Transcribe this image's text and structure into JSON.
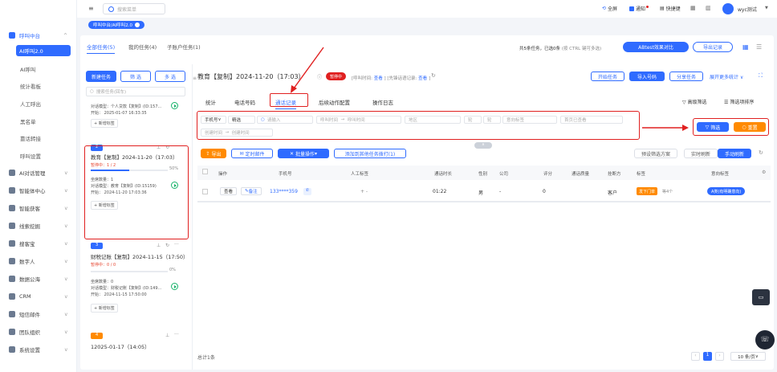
{
  "topbar": {
    "search_placeholder": "搜索菜单",
    "links": [
      "全屏",
      "通知",
      "快捷键"
    ],
    "user": "wyc测试"
  },
  "breadcrumb": "呼叫中台/AI呼叫2.0",
  "sidebar": {
    "top_item": "呼叫中台",
    "sub_items": [
      "AI呼叫2.0",
      "AI呼叫",
      "统计看板",
      "人工呼出",
      "黑名单",
      "靠话转接",
      "呼叫设置"
    ],
    "groups": [
      "AI对话管理",
      "智能体中心",
      "智能获客",
      "线索挖掘",
      "搜客宝",
      "数字人",
      "数据公海",
      "CRM",
      "短信邮件",
      "团队组织",
      "系统设置"
    ]
  },
  "panel": {
    "tabs": [
      "全部任务(5)",
      "我的任务(4)",
      "子账户任务(1)"
    ],
    "summary": "共5条任务，已选0条",
    "summary_hint": "(按 CTRL 键可多选)",
    "abtest": "ABtest效果对比",
    "export_records": "导出记录",
    "left_buttons": {
      "new_task": "新建任务",
      "filter": "筛 选",
      "multi": "多 选"
    },
    "left_search_placeholder": "搜索任务(回车)",
    "task_title": "教育【复制】2024-11-20（17:03）",
    "task_status": "暂停中",
    "task_meta_1": "[呼叫时间:",
    "task_meta_link_1": "查看",
    "task_meta_2": "] [先锋话语记录:",
    "task_meta_link_2": "查看",
    "task_meta_3": "]",
    "header_buttons": [
      "开始任务",
      "导入号码",
      "分享任务",
      "展开更多统计"
    ],
    "sub_tabs": [
      "统计",
      "电话号码",
      "通话记录",
      "后续动作配置",
      "操作日志"
    ],
    "adv_filter": "高级筛选",
    "col_sort": "筛选项排序",
    "filters": {
      "phone_field": "手机号",
      "match_mode": "精选",
      "search_placeholder": "请输入",
      "call_time_start": "呼叫时间",
      "call_time_end": "呼叫时间",
      "region": "地区",
      "count_from": "轮",
      "count_to": "轮",
      "intent_tag": "意向标签",
      "first_view": "首页已查看",
      "created_start": "创建时间",
      "created_end": "创建时间"
    },
    "filter_btn": "筛选",
    "reset_btn": "重置",
    "action_buttons": [
      "导出",
      "定时邮件",
      "批量操作",
      "添加到其他任务拨打(1)"
    ],
    "right_actions": [
      "预设筛选方案",
      "实时刷新",
      "手动刷新"
    ],
    "table": {
      "headers": [
        "操作",
        "手机号",
        "人工标签",
        "通话时长",
        "性别",
        "公司",
        "评分",
        "通话质量",
        "挂断方",
        "标签",
        "意向标签"
      ],
      "row": {
        "view": "查看",
        "note": "备注",
        "phone": "133****359",
        "manual_tag": "+ -",
        "duration": "01:22",
        "gender": "男",
        "company": "-",
        "score": "0",
        "hangup": "客户",
        "tag": "发下门单",
        "tag_extra": "等4个",
        "intent": "A类(有明确意向)"
      }
    },
    "total": "总计1条",
    "pager": {
      "page": "1",
      "page_size": "10 条/页"
    }
  },
  "tasks": [
    {
      "num": "",
      "title": "",
      "status": "",
      "pct": "",
      "lines": [
        "对话模型：个人贷款【复制】(ID:157...",
        "开始：   2025-01-07 16:33:35"
      ],
      "tag": "+ 新增标签"
    },
    {
      "num": "2",
      "title": "教育【复制】2024-11-20（17:03）",
      "status": "暂停中：1 / 2",
      "pct": "50%",
      "progress": 0.5,
      "lines": [
        "坐席数量：1",
        "对话模型：教育【复制】(ID:15159)",
        "开始：   2024-11-20 17:03:36"
      ],
      "tag": "+ 新增标签"
    },
    {
      "num": "3",
      "title": "财税记账【复制】2024-11-15（17:50）",
      "status": "暂停中：0 / 0",
      "pct": "0%",
      "progress": 0,
      "lines": [
        "坐席数量：0",
        "对话模型：财税记账【复制】(ID:149...",
        "开始：   2024-11-15 17:50:00"
      ],
      "tag": "+ 新增标签"
    },
    {
      "num": "4",
      "title": "12025-01-17（14:05）",
      "status": "",
      "pct": "",
      "lines": [],
      "tag": ""
    }
  ]
}
